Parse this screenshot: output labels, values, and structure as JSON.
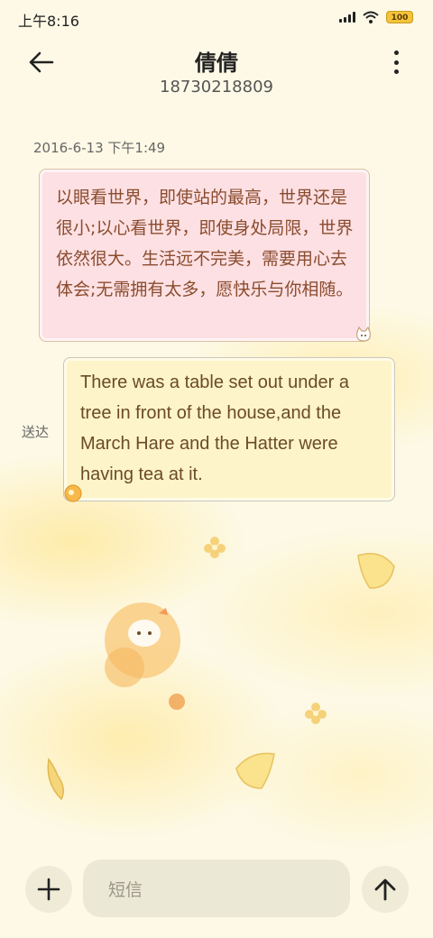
{
  "status_bar": {
    "time": "上午8:16",
    "battery": "100"
  },
  "header": {
    "contact_name": "倩倩",
    "phone_number": "18730218809",
    "back_icon": "arrow-left-icon",
    "more_icon": "vertical-dots-icon"
  },
  "conversation": {
    "timestamp": "2016-6-13 下午1:49",
    "incoming_message": "以眼看世界，即使站的最高，世界还是很小;以心看世界，即使身处局限，世界依然很大。生活远不完美，需要用心去体会;无需拥有太多，愿快乐与你相随。",
    "outgoing_message": "There was a table set out under a tree in front of the house,and the March Hare and the Hatter were having tea at it.",
    "delivery_status": "送达"
  },
  "composer": {
    "placeholder": "短信",
    "add_icon": "plus-icon",
    "send_icon": "arrow-up-icon"
  },
  "colors": {
    "background": "#fdf9e6",
    "incoming_bubble": "#fde0e3",
    "outgoing_bubble": "#fdf4c9",
    "message_text": "#8a4c2e"
  }
}
